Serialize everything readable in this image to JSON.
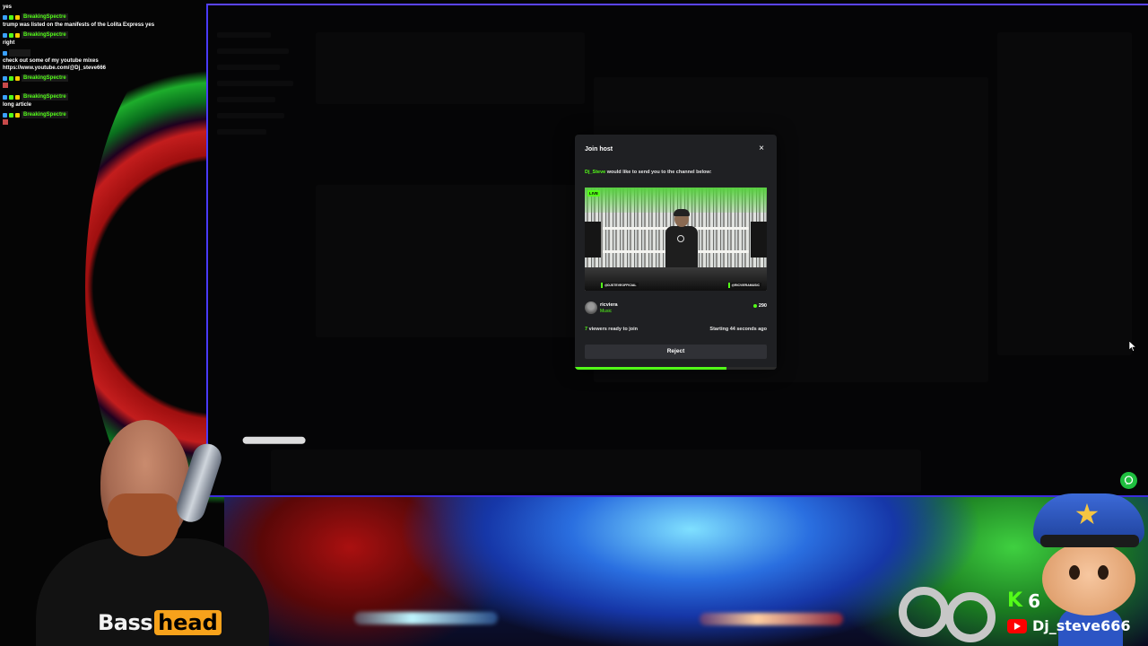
{
  "chat": {
    "messages": [
      {
        "user": "",
        "text": "yes"
      },
      {
        "user": "BreakingSpectre",
        "text": "trump was listed on the manifests of the Lolita Express yes"
      },
      {
        "user": "BreakingSpectre",
        "text": "right"
      },
      {
        "user": "",
        "text": "check out some of my youtube mixes https://www.youtube.com/@Dj_steve666"
      },
      {
        "user": "BreakingSpectre",
        "text": ""
      },
      {
        "user": "BreakingSpectre",
        "text": "long article"
      },
      {
        "user": "BreakingSpectre",
        "text": ""
      }
    ]
  },
  "dialog": {
    "title": "Join host",
    "close_icon": "×",
    "host_name": "Dj_Steve",
    "message": " would like to send you to the channel below:",
    "live_label": "LIVE",
    "lower_third_left": "@DJSTEVEOFFICIAL",
    "lower_third_right": "@RICVIERAMUSIC",
    "channel": {
      "name": "ricviera",
      "category": "Music",
      "viewers": "290"
    },
    "ready_count": "7",
    "ready_text": " viewers ready to join",
    "starting_text": "Starting 44 seconds ago",
    "reject_label": "Reject",
    "countdown_progress": 0.75,
    "accent_color": "#53fc18"
  },
  "overlay": {
    "brand_word_1": "Bass",
    "brand_word_2": "head",
    "kick_letter": "K",
    "kick_followers": "6",
    "youtube_name": "Dj_steve666"
  }
}
